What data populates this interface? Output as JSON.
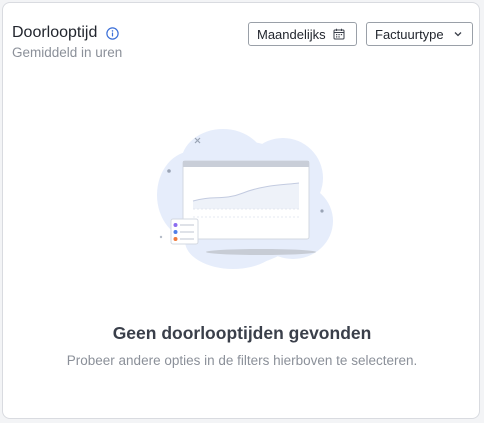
{
  "widget": {
    "title": "Doorlooptijd",
    "subtitle": "Gemiddeld in uren",
    "info_icon": "info-circle-icon"
  },
  "filters": {
    "period_label": "Maandelijks",
    "period_icon": "calendar-icon",
    "type_label": "Factuurtype",
    "type_icon": "chevron-down-icon"
  },
  "empty_state": {
    "title": "Geen doorlooptijden gevonden",
    "description": "Probeer andere opties in de filters hierboven te selecteren.",
    "illustration": "empty-chart-illustration"
  },
  "colors": {
    "accent": "#3b6fd8",
    "illustration_bg": "#e6edfb",
    "dot_purple": "#8b6cf0",
    "dot_blue": "#4f7fe8",
    "dot_orange": "#ef7a3c"
  }
}
